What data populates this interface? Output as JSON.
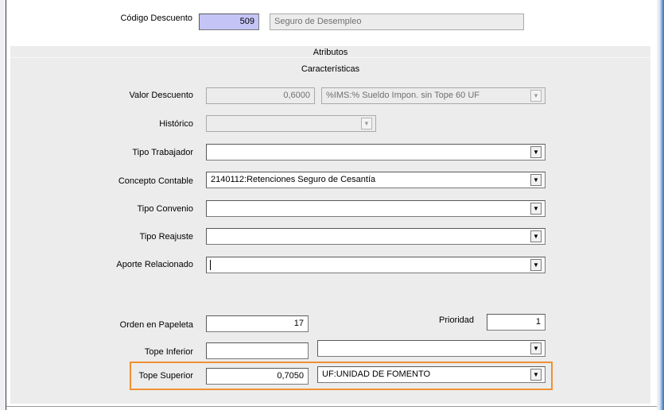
{
  "header": {
    "codigo_label": "Código Descuento",
    "codigo_value": "509",
    "descripcion_value": "Seguro de Desempleo"
  },
  "sections": {
    "atributos": "Atributos",
    "caracteristicas": "Características"
  },
  "fields": {
    "valor_descuento": {
      "label": "Valor Descuento",
      "value": "0,6000",
      "unit": "%IMS:% Sueldo Impon. sin Tope 60 UF"
    },
    "historico": {
      "label": "Histórico",
      "value": ""
    },
    "tipo_trabajador": {
      "label": "Tipo Trabajador",
      "value": ""
    },
    "concepto_contable": {
      "label": "Concepto Contable",
      "value": "2140112:Retenciones Seguro de Cesantía"
    },
    "tipo_convenio": {
      "label": "Tipo Convenio",
      "value": ""
    },
    "tipo_reajuste": {
      "label": "Tipo Reajuste",
      "value": ""
    },
    "aporte_relacionado": {
      "label": "Aporte Relacionado",
      "value": ""
    },
    "orden_papeleta": {
      "label": "Orden en Papeleta",
      "value": "17"
    },
    "prioridad": {
      "label": "Prioridad",
      "value": "1"
    },
    "tope_inferior": {
      "label": "Tope Inferior",
      "value": "",
      "unit": ""
    },
    "tope_superior": {
      "label": "Tope Superior",
      "value": "0,7050",
      "unit": "UF:UNIDAD DE FOMENTO"
    }
  },
  "icons": {
    "dropdown": "▼"
  },
  "colors": {
    "highlight_border": "#ee9033",
    "codigo_background": "#c4c4f6",
    "panel_background": "#ececec"
  }
}
